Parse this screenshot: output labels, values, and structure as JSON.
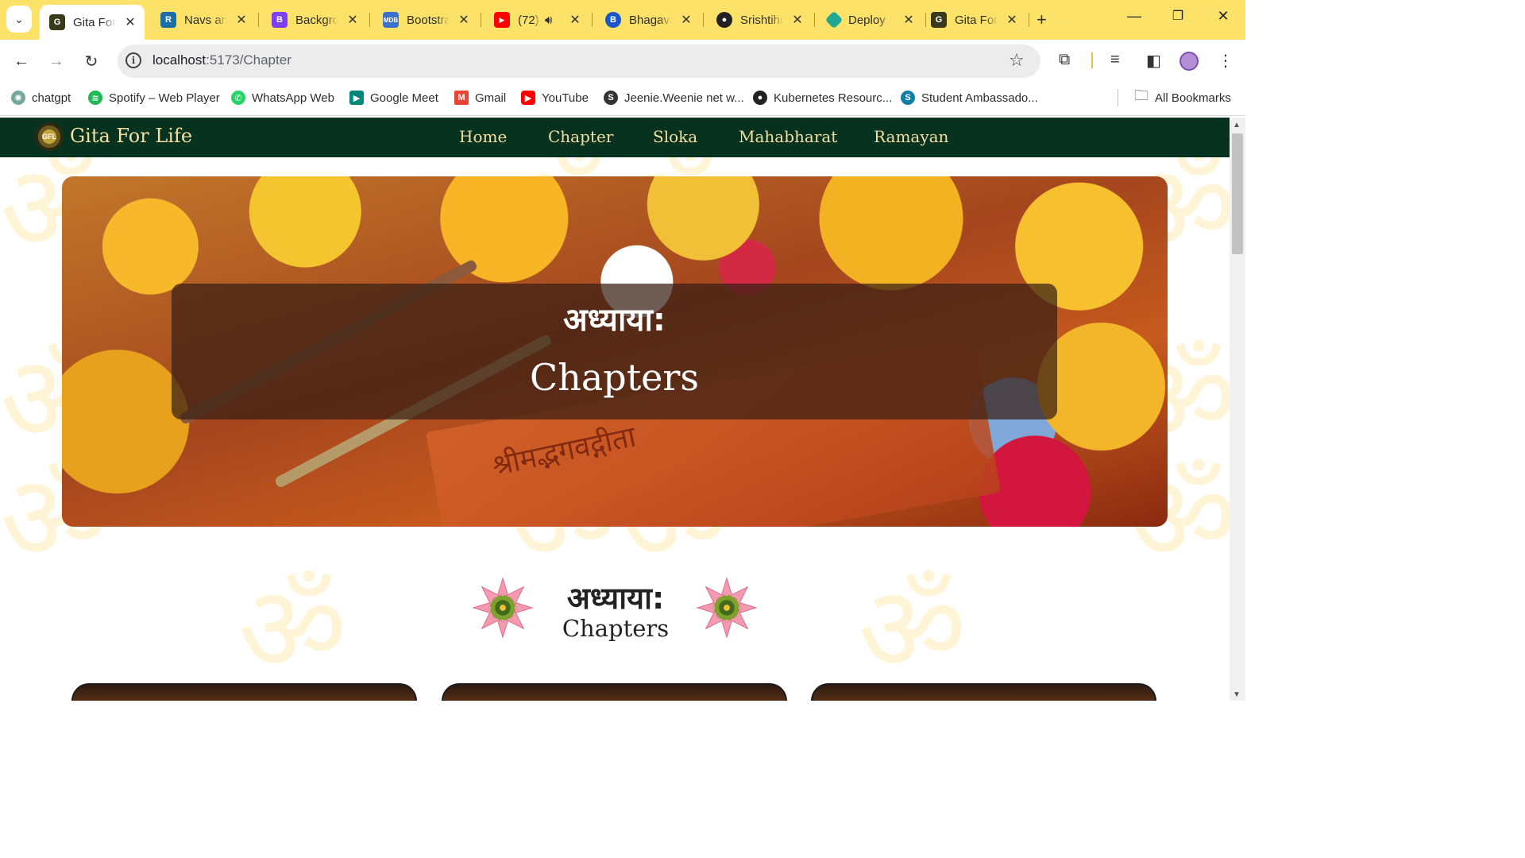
{
  "browser": {
    "tabs": [
      {
        "title": "Gita For Life",
        "favicon": "gfl-logo",
        "color": "#3a3a1a",
        "active": true
      },
      {
        "title": "Navs and tabs",
        "favicon": "react-bootstrap-logo",
        "color": "#1b6fa8",
        "active": false
      },
      {
        "title": "Background",
        "favicon": "bootstrap-logo",
        "color": "#7e3ff2",
        "active": false
      },
      {
        "title": "Bootstrap",
        "favicon": "mdb-logo",
        "color": "#3b71ca",
        "active": false
      },
      {
        "title": "(72)",
        "favicon": "youtube-logo",
        "color": "#ff0000",
        "active": false,
        "audio": true
      },
      {
        "title": "Bhagavad",
        "favicon": "bhagavad-logo",
        "color": "#1a56c8",
        "active": false
      },
      {
        "title": "Srishtihub",
        "favicon": "github-logo",
        "color": "#222222",
        "active": false
      },
      {
        "title": "Deploy",
        "favicon": "netlify-logo",
        "color": "#1fa896",
        "active": false
      },
      {
        "title": "Gita For Life",
        "favicon": "gfl-logo",
        "color": "#3a3a1a",
        "active": false
      }
    ],
    "url": {
      "host": "localhost",
      "rest": ":5173/Chapter"
    },
    "bookmarks": [
      {
        "label": "chatgpt",
        "icon": "chatgpt-icon",
        "color": "#74aa9c"
      },
      {
        "label": "Spotify – Web Player",
        "icon": "spotify-icon",
        "color": "#1db954"
      },
      {
        "label": "WhatsApp Web",
        "icon": "whatsapp-icon",
        "color": "#25d366"
      },
      {
        "label": "Google Meet",
        "icon": "meet-icon",
        "color": "#00897b"
      },
      {
        "label": "Gmail",
        "icon": "gmail-icon",
        "color": "#ea4335"
      },
      {
        "label": "YouTube",
        "icon": "youtube-icon",
        "color": "#ff0000"
      },
      {
        "label": "Jeenie.Weenie net w...",
        "icon": "jeenie-icon",
        "color": "#333333"
      },
      {
        "label": "Kubernetes Resourc...",
        "icon": "github-icon",
        "color": "#222222"
      },
      {
        "label": "Student Ambassado...",
        "icon": "sharepoint-icon",
        "color": "#0f7fa8"
      }
    ],
    "all_bookmarks": "All Bookmarks"
  },
  "site": {
    "brand": "Gita For Life",
    "nav": [
      "Home",
      "Chapter",
      "Sloka",
      "Mahabharat",
      "Ramayan"
    ],
    "hero": {
      "devanagari": "अध्याया:",
      "english": "Chapters",
      "book_text": "श्रीमद्भगवद्गीता"
    },
    "section": {
      "devanagari": "अध्याया:",
      "english": "Chapters"
    },
    "colors": {
      "nav_bg": "#06321f",
      "nav_text": "#f6dfa0",
      "om_watermark": "#fff3cc"
    }
  }
}
